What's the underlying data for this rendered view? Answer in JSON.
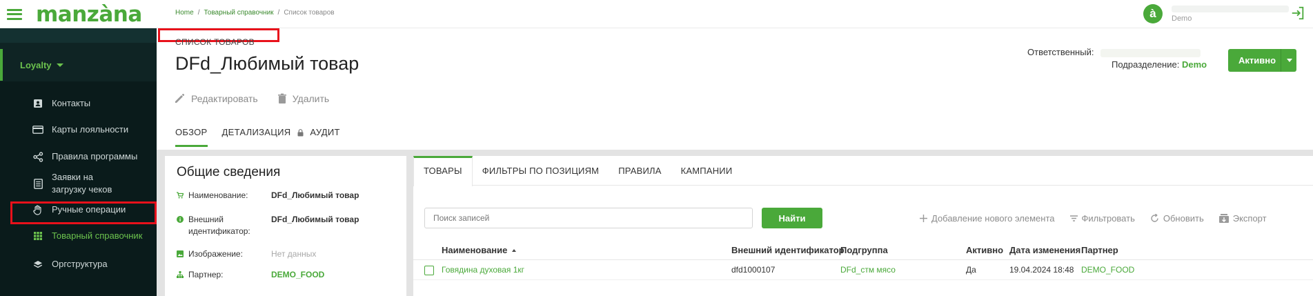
{
  "app": {
    "logo": "manzàna"
  },
  "breadcrumb": {
    "home": "Home",
    "catalog": "Товарный справочник",
    "current": "Список товаров",
    "sep": "/"
  },
  "user": {
    "avatar_letter": "à",
    "org": "Demo"
  },
  "sidebar": {
    "section": "Loyalty",
    "items": [
      {
        "label": "Контакты",
        "icon": "contact-card-icon"
      },
      {
        "label": "Карты лояльности",
        "icon": "credit-card-icon"
      },
      {
        "label": "Правила программы",
        "icon": "share-nodes-icon"
      },
      {
        "label": "Заявки на загрузку чеков",
        "icon": "receipt-icon"
      },
      {
        "label": "Ручные операции",
        "icon": "hand-icon"
      },
      {
        "label": "Товарный справочник",
        "icon": "grid-icon",
        "active": true
      },
      {
        "label": "Оргструктура",
        "icon": "layers-icon"
      }
    ]
  },
  "header": {
    "page_type": "СПИСОК ТОВАРОВ",
    "title": "DFd_Любимый товар",
    "responsible_label": "Ответственный:",
    "department_label": "Подразделение:",
    "department_value": "Demo",
    "status_label": "Активно"
  },
  "actions": {
    "edit": "Редактировать",
    "delete": "Удалить"
  },
  "tabs": {
    "overview": "ОБЗОР",
    "details": "ДЕТАЛИЗАЦИЯ",
    "audit": "АУДИТ"
  },
  "general_info": {
    "title": "Общие сведения",
    "rows": [
      {
        "label": "Наименование:",
        "value": "DFd_Любимый товар",
        "icon": "cart-icon"
      },
      {
        "label": "Внешний идентификатор:",
        "value": "DFd_Любимый товар",
        "icon": "info-icon"
      },
      {
        "label": "Изображение:",
        "value": "Нет данных",
        "icon": "image-icon"
      },
      {
        "label": "Партнер:",
        "value": "DEMO_FOOD",
        "icon": "org-tree-icon"
      }
    ]
  },
  "inner_tabs": {
    "goods": "ТОВАРЫ",
    "filters": "ФИЛЬТРЫ ПО ПОЗИЦИЯМ",
    "rules": "ПРАВИЛА",
    "campaigns": "КАМПАНИИ"
  },
  "search": {
    "placeholder": "Поиск записей",
    "button": "Найти"
  },
  "toolbar": {
    "add": "Добавление нового элемента",
    "filter": "Фильтровать",
    "refresh": "Обновить",
    "export": "Экспорт"
  },
  "table": {
    "columns": [
      "Наименование",
      "Внешний идентификатор",
      "Подгруппа",
      "Активно",
      "Дата изменения",
      "Партнер"
    ],
    "rows": [
      {
        "name": "Говядина духовая 1кг",
        "external_id": "dfd1000107",
        "subgroup": "DFd_стм мясо",
        "active": "Да",
        "modified": "19.04.2024 18:48",
        "partner": "DEMO_FOOD"
      }
    ]
  },
  "colors": {
    "brand": "#4aa93a",
    "sidebar_bg": "#0a1b1b",
    "highlight": "#e8111b"
  }
}
